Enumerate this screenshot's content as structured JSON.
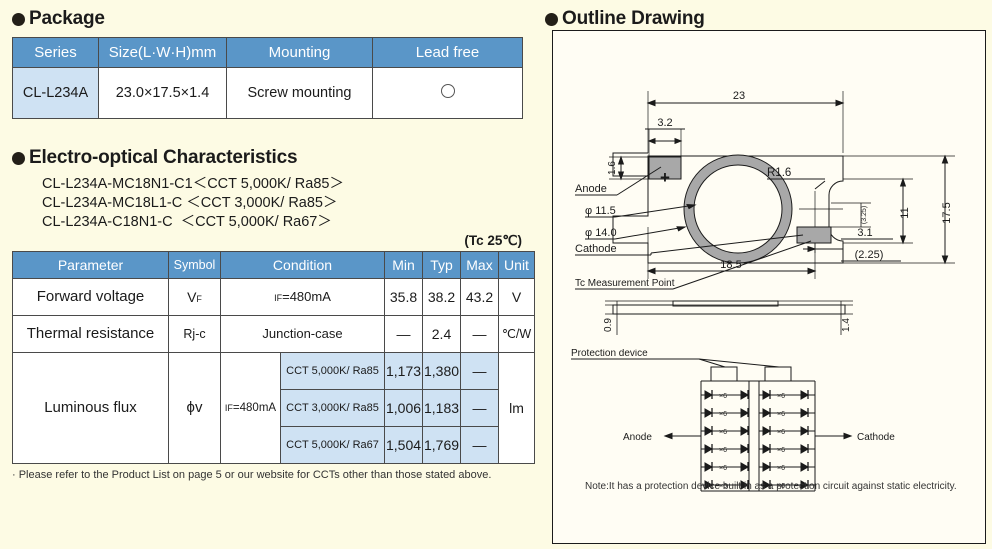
{
  "sections": {
    "package_title": "Package",
    "eo_title": "Electro-optical Characteristics",
    "outline_title": "Outline Drawing"
  },
  "package_table": {
    "headers": [
      "Series",
      "Size(L·W·H)mm",
      "Mounting",
      "Lead free"
    ],
    "row": {
      "series": "CL-L234A",
      "size": "23.0×17.5×1.4",
      "mounting": "Screw mounting",
      "lead_free": "○"
    }
  },
  "part_codes": [
    "CL-L234A-MC18N1-C1＜CCT 5,000K/ Ra85＞",
    "CL-L234A-MC18L1-C ＜CCT 3,000K/ Ra85＞",
    "CL-L234A-C18N1-C  ＜CCT 5,000K/ Ra67＞"
  ],
  "test_condition": "(Tc 25℃)",
  "eo_table": {
    "headers": [
      "Parameter",
      "Symbol",
      "Condition",
      "Min",
      "Typ",
      "Max",
      "Unit"
    ],
    "rows": [
      {
        "parameter": "Forward voltage",
        "symbol": "V",
        "symbol_sub": "F",
        "condition": "I",
        "condition_sub": "F",
        "condition_rest": "=480mA",
        "min": "35.8",
        "typ": "38.2",
        "max": "43.2",
        "unit": "V"
      },
      {
        "parameter": "Thermal resistance",
        "symbol": "Rj-c",
        "condition": "Junction-case",
        "min": "—",
        "typ": "2.4",
        "max": "—",
        "unit": "℃/W"
      }
    ],
    "luminous": {
      "parameter": "Luminous flux",
      "symbol": "ϕv",
      "condition": "I",
      "condition_sub": "F",
      "condition_rest": "=480mA",
      "unit": "lm",
      "subrows": [
        {
          "cct": "CCT 5,000K/ Ra85",
          "min": "1,173",
          "typ": "1,380",
          "max": "—"
        },
        {
          "cct": "CCT 3,000K/ Ra85",
          "min": "1,006",
          "typ": "1,183",
          "max": "—"
        },
        {
          "cct": "CCT 5,000K/ Ra67",
          "min": "1,504",
          "typ": "1,769",
          "max": "—"
        }
      ]
    }
  },
  "footnote": "· Please refer to the Product List on page 5 or our website for CCTs other than those stated above.",
  "drawing": {
    "dimensions": {
      "width_overall": "23",
      "pad_width": "3.2",
      "pad_height": "1.6",
      "radius": "R1.6",
      "inner_dia": "φ 11.5",
      "outer_dia": "φ 14.0",
      "height_11": "11",
      "height_overall": "17.5",
      "cathode_dist": "18.5",
      "cathode_offset": "3.1",
      "bracket_225": "(2.25)",
      "bracket_325": "(3.25)",
      "side_top": "0.9",
      "side_thickness": "1.4"
    },
    "labels": {
      "anode": "Anode",
      "cathode": "Cathode",
      "tc_point": "Tc Measurement Point",
      "plus": "+",
      "protection_device": "Protection device",
      "circuit_anode": "Anode",
      "circuit_cathode": "Cathode",
      "multiplier": "×6"
    },
    "note": "Note:It has a protection device built in as a protection circuit against static electricity."
  },
  "colors": {
    "header_blue": "#5a96c8",
    "tint_blue": "#cfe2f3",
    "page_bg": "#fdfbe4",
    "ink": "#1b1b1b"
  }
}
